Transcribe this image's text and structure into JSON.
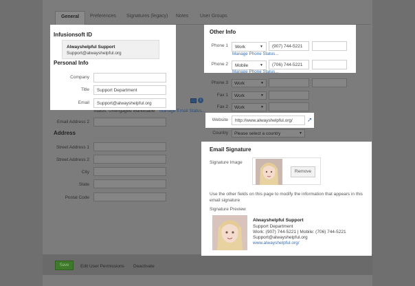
{
  "tabs": [
    "General",
    "Preferences",
    "Signatures (legacy)",
    "Notes",
    "User Groups"
  ],
  "infusionsoft_id": {
    "title": "Infusionsoft ID",
    "name": "Alwayshelpful Support",
    "email": "Support@alwayshelpful.org"
  },
  "personal_info": {
    "title": "Personal Info",
    "company_label": "Company",
    "company_value": "",
    "title_label": "Title",
    "title_value": "Support Department",
    "email_label": "Email",
    "email_value": "Support@alwayshelpful.org",
    "email_status": "Status: Unengaged Marketable",
    "manage_email_status": "Manage Email Status...",
    "email2_label": "Email Address 2"
  },
  "address": {
    "title": "Address",
    "labels": [
      "Street Address 1",
      "Street Address 2",
      "City",
      "State",
      "Postal Code"
    ]
  },
  "other_info": {
    "title": "Other Info",
    "phone1_label": "Phone 1",
    "phone1_type": "Work",
    "phone1_value": "(907) 744-5221",
    "manage_phone_status": "Manage Phone Status...",
    "phone2_label": "Phone 2",
    "phone2_type": "Mobile",
    "phone2_value": "(706) 744-5221",
    "phone3_label": "Phone 3",
    "phone3_type": "Work",
    "fax1_label": "Fax 1",
    "fax1_type": "Work",
    "fax2_label": "Fax 2",
    "fax2_type": "Work",
    "website_label": "Website",
    "website_value": "http://www.alwayshelpful.org/",
    "country_label": "Country",
    "country_value": "Please select a country"
  },
  "email_signature": {
    "title": "Email Signature",
    "image_label": "Signature Image",
    "remove_label": "Remove",
    "note": "Use the other fields on this page to modify the information that appears in this email signature",
    "preview_label": "Signature Preview",
    "preview_name": "Alwayshelpful Support",
    "preview_dept": "Support Department",
    "preview_phones": "Work: (907) 744-5221 | Mobile: (706) 744-5221",
    "preview_email": "Support@alwayshelpful.org",
    "preview_site": "www.alwayshelpful.org/"
  },
  "footer": {
    "save": "Save",
    "edit_permissions": "Edit User Permissions",
    "deactivate": "Deactivate"
  },
  "colors": {
    "overlay": "#7c7c7c",
    "link": "#3e6fae",
    "save_green": "#3f7a2b"
  },
  "icons": [
    "envelope-icon",
    "info-icon",
    "external-link-icon"
  ]
}
